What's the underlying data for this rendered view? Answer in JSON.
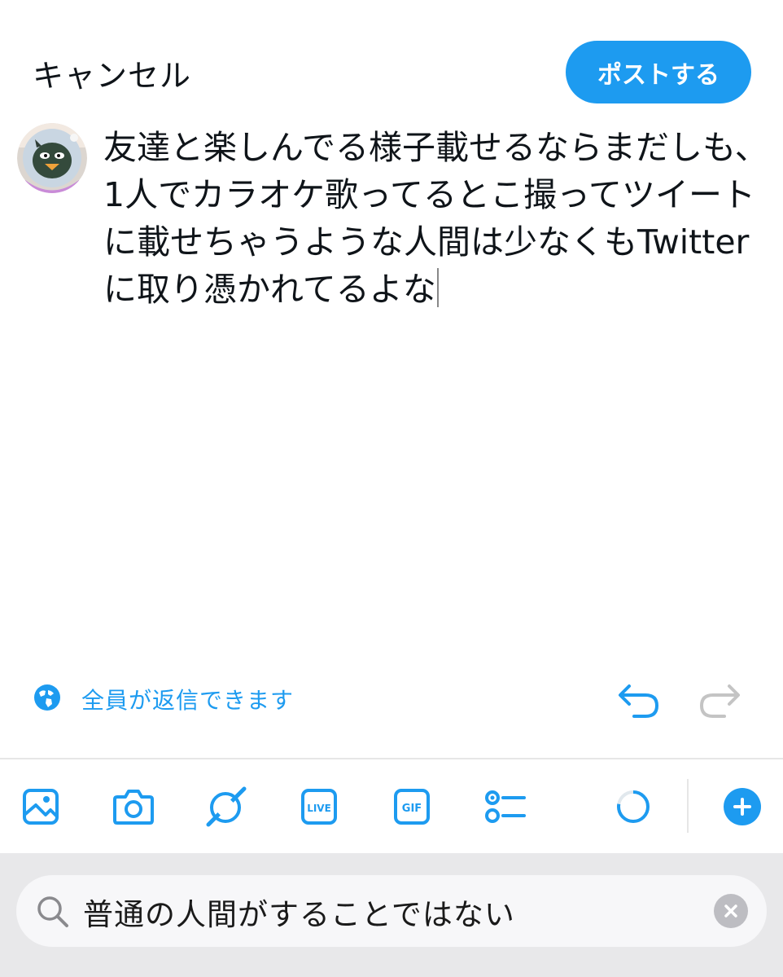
{
  "header": {
    "cancel_label": "キャンセル",
    "post_label": "ポストする"
  },
  "compose": {
    "text": "友達と楽しんでる様子載せるならまだしも、\n1人でカラオケ歌ってるとこ撮ってツイート\nに載せちゃうような人間は少なくもTwitter\nに取り憑かれてるよな"
  },
  "reply_settings": {
    "label": "全員が返信できます",
    "icon": "globe-icon"
  },
  "toolbar": {
    "icons": [
      "image-icon",
      "camera-icon",
      "grok-icon",
      "live-icon",
      "gif-icon",
      "poll-icon",
      "character-count-ring-icon",
      "add-post-icon"
    ],
    "live_label": "LIVE",
    "gif_label": "GIF"
  },
  "keyboard": {
    "search_value": "普通の人間がすることではない"
  },
  "colors": {
    "accent": "#1d9bf0",
    "text": "#0f1419",
    "disabled": "#c4c4c4"
  }
}
